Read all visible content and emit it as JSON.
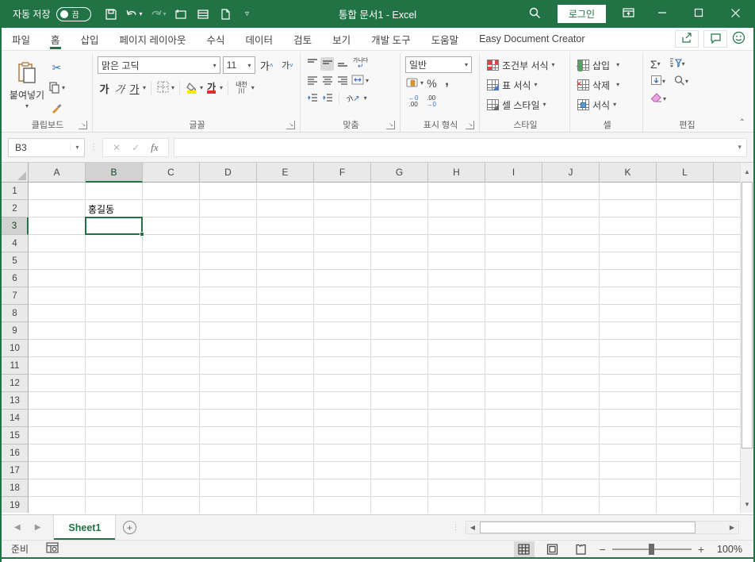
{
  "accent": "#217346",
  "titlebar": {
    "autosave_label": "자동 저장",
    "autosave_state": "끔",
    "title": "통합 문서1",
    "separator": "-",
    "app_name": "Excel",
    "login_label": "로그인"
  },
  "tabs": [
    {
      "label": "파일"
    },
    {
      "label": "홈",
      "active": true
    },
    {
      "label": "삽입"
    },
    {
      "label": "페이지 레이아웃"
    },
    {
      "label": "수식"
    },
    {
      "label": "데이터"
    },
    {
      "label": "검토"
    },
    {
      "label": "보기"
    },
    {
      "label": "개발 도구"
    },
    {
      "label": "도움말"
    },
    {
      "label": "Easy Document Creator"
    }
  ],
  "ribbon": {
    "clipboard": {
      "paste_label": "붙여넣기",
      "group_label": "클립보드"
    },
    "font": {
      "font_name": "맑은 고딕",
      "font_size": "11",
      "grow_letter": "가",
      "shrink_letter": "가",
      "bold_letter": "가",
      "italic_letter": "가",
      "underline_letter": "가",
      "color_letter": "가",
      "phonetic_top": "내천",
      "phonetic_bottom": "川",
      "group_label": "글꼴"
    },
    "alignment": {
      "wrap_text": "가나다",
      "orient_letter": "가",
      "group_label": "맞춤"
    },
    "number": {
      "format": "일반",
      "percent": "%",
      "comma": ",",
      "inc_top": "←0",
      "inc_bottom": ".00",
      "dec_top": ".00",
      "dec_bottom": "→0",
      "group_label": "표시 형식"
    },
    "styles": {
      "items": [
        "조건부 서식",
        "표 서식",
        "셀 스타일"
      ],
      "group_label": "스타일"
    },
    "cells": {
      "items": [
        "삽입",
        "삭제",
        "서식"
      ],
      "group_label": "셀"
    },
    "editing": {
      "sigma": "Σ",
      "group_label": "편집"
    }
  },
  "formula_bar": {
    "name_box": "B3",
    "cancel": "✕",
    "enter": "✓",
    "fx": "fx",
    "value": ""
  },
  "grid": {
    "columns": [
      "A",
      "B",
      "C",
      "D",
      "E",
      "F",
      "G",
      "H",
      "I",
      "J",
      "K",
      "L"
    ],
    "row_count": 19,
    "selected_column": "B",
    "selected_row": 3,
    "active_cell": "B3",
    "cells": [
      {
        "ref": "B2",
        "text": "홍길동"
      }
    ]
  },
  "sheet_bar": {
    "sheet_name": "Sheet1"
  },
  "status_bar": {
    "ready": "준비",
    "zoom_minus": "−",
    "zoom_plus": "+",
    "zoom_pct": "100%"
  }
}
